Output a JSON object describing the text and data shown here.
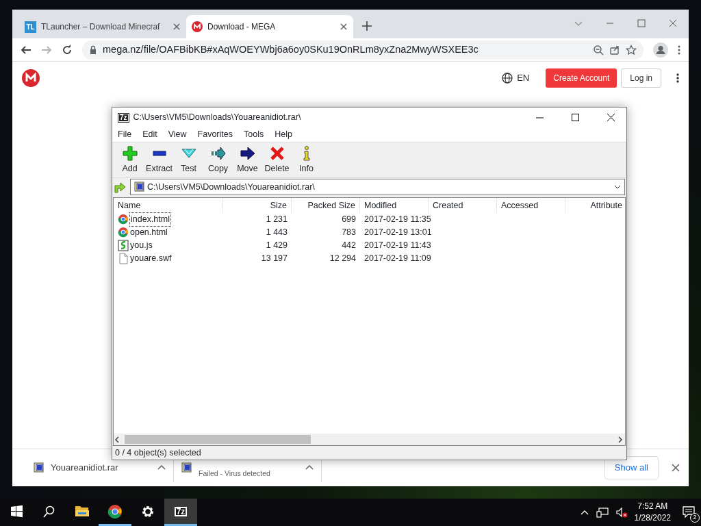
{
  "browser": {
    "tabs": [
      {
        "icon_text": "TL",
        "title": "TLauncher – Download Minecraf",
        "selected": false
      },
      {
        "title": "Download - MEGA",
        "selected": true
      }
    ],
    "url": "mega.nz/file/OAFBibKB#xAqWOEYWbj6a6oy0SKu19OnRLm8yxZna2MwyWSXEE3c",
    "site": {
      "language": "EN",
      "create_account": "Create Account",
      "login": "Log in"
    },
    "downloads": [
      {
        "name": "Youareanidiot.rar"
      },
      {
        "status": "Failed - Virus detected"
      }
    ],
    "show_all": "Show all"
  },
  "archiver": {
    "icon_text": "7z",
    "title": "C:\\Users\\VM5\\Downloads\\Youareanidiot.rar\\",
    "menu": [
      "File",
      "Edit",
      "View",
      "Favorites",
      "Tools",
      "Help"
    ],
    "toolbar": [
      {
        "kind": "add",
        "label": "Add"
      },
      {
        "kind": "extract",
        "label": "Extract"
      },
      {
        "kind": "test",
        "label": "Test"
      },
      {
        "kind": "copy",
        "label": "Copy"
      },
      {
        "kind": "move",
        "label": "Move"
      },
      {
        "kind": "delete",
        "label": "Delete"
      },
      {
        "kind": "info",
        "label": "Info"
      }
    ],
    "path": "C:\\Users\\VM5\\Downloads\\Youareanidiot.rar\\",
    "columns": [
      "Name",
      "Size",
      "Packed Size",
      "Modified",
      "Created",
      "Accessed",
      "Attribute"
    ],
    "rows": [
      {
        "kind": "chrome",
        "name": "index.html",
        "size": "1 231",
        "packed_size": "699",
        "modified": "2017-02-19 11:35",
        "focused": true
      },
      {
        "kind": "chrome",
        "name": "open.html",
        "size": "1 443",
        "packed_size": "783",
        "modified": "2017-02-19 13:01",
        "focused": false
      },
      {
        "kind": "script",
        "name": "you.js",
        "size": "1 429",
        "packed_size": "442",
        "modified": "2017-02-19 11:43",
        "focused": false
      },
      {
        "kind": "file",
        "name": "youare.swf",
        "size": "13 197",
        "packed_size": "12 294",
        "modified": "2017-02-19 11:09",
        "focused": false
      }
    ],
    "status": "0 / 4 object(s) selected"
  },
  "taskbar": {
    "apps": [
      {
        "kind": "explorer",
        "running": false,
        "active": false
      },
      {
        "kind": "chrome",
        "running": true,
        "active": false
      },
      {
        "kind": "settings",
        "running": false,
        "active": false
      },
      {
        "kind": "archiver",
        "text": "7z",
        "running": true,
        "active": true
      }
    ],
    "time": "7:52 AM",
    "date": "1/28/2022",
    "notifications": "2"
  }
}
